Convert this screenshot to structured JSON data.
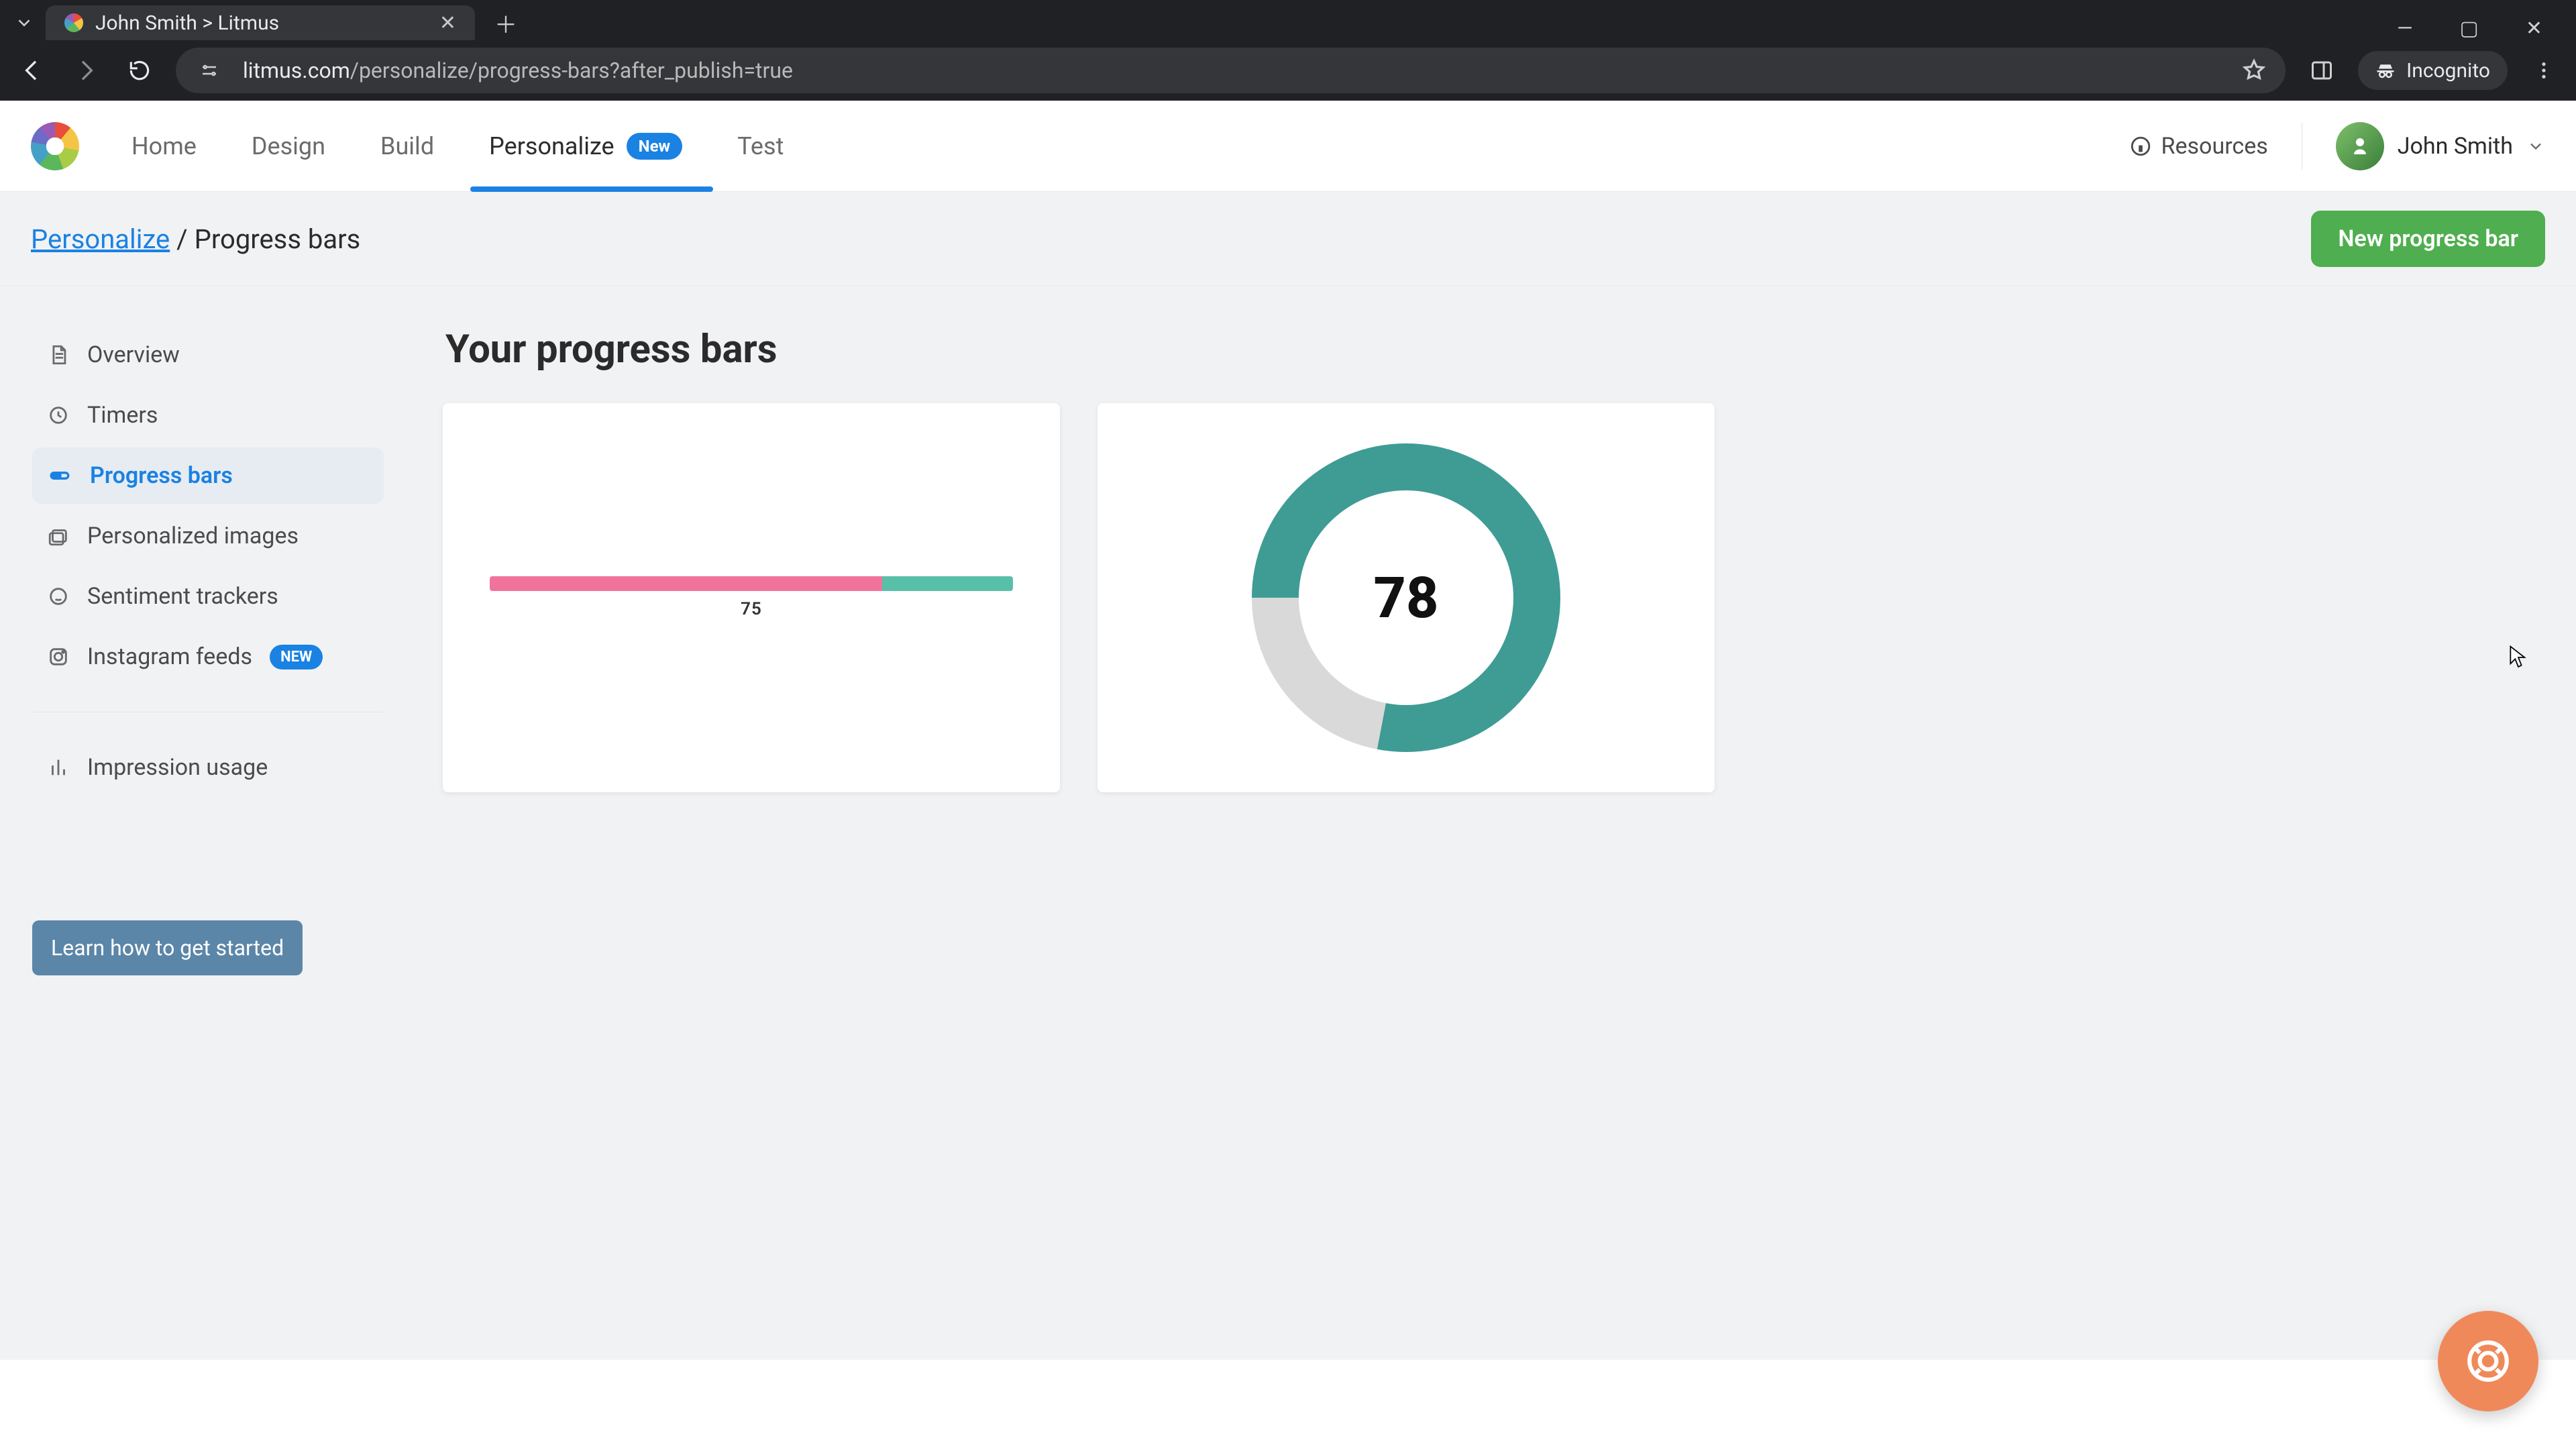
{
  "browser": {
    "tab_title": "John Smith > Litmus",
    "url_host": "litmus.com",
    "url_path": "/personalize/progress-bars?after_publish=true",
    "incognito": "Incognito"
  },
  "nav": {
    "home": "Home",
    "design": "Design",
    "build": "Build",
    "personalize": "Personalize",
    "personalize_badge": "New",
    "test": "Test",
    "resources": "Resources",
    "user": "John Smith"
  },
  "breadcrumb": {
    "root": "Personalize",
    "sep": " / ",
    "leaf": "Progress bars"
  },
  "actions": {
    "new_progress_bar": "New progress bar",
    "learn": "Learn how to get started"
  },
  "sidebar": {
    "items": [
      {
        "label": "Overview"
      },
      {
        "label": "Timers"
      },
      {
        "label": "Progress bars"
      },
      {
        "label": "Personalized images"
      },
      {
        "label": "Sentiment trackers"
      },
      {
        "label": "Instagram feeds",
        "badge": "NEW"
      }
    ],
    "impression": "Impression usage"
  },
  "page": {
    "title": "Your progress bars"
  },
  "cards": {
    "linear": {
      "value": "75"
    },
    "radial": {
      "value": "78"
    }
  }
}
